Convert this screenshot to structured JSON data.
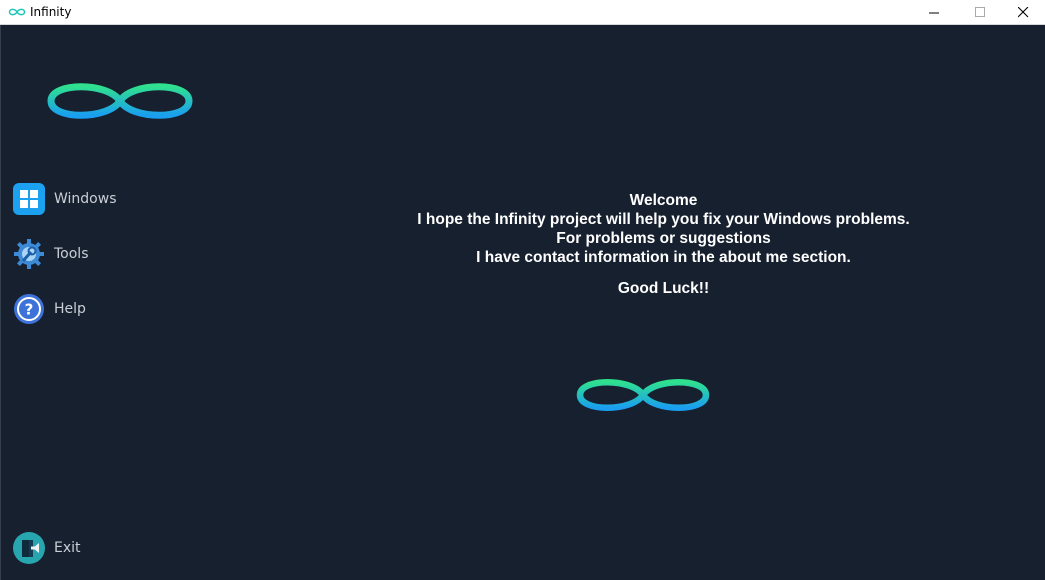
{
  "window": {
    "title": "Infinity",
    "controls": {
      "minimize": "minimize",
      "maximize": "maximize",
      "close": "close"
    }
  },
  "colors": {
    "background": "#17202f",
    "logo_gradient_start": "#2fe08f",
    "logo_gradient_end": "#1a9ff0",
    "text": "#ffffff",
    "sidebar_text": "#c9cfd6"
  },
  "sidebar": {
    "items": [
      {
        "label": "Windows",
        "icon": "windows-icon"
      },
      {
        "label": "Tools",
        "icon": "tools-gear-icon"
      },
      {
        "label": "Help",
        "icon": "help-icon"
      }
    ],
    "exit": {
      "label": "Exit",
      "icon": "exit-door-icon"
    }
  },
  "content": {
    "welcome": "Welcome",
    "line1": "I hope the Infinity project will help you fix your Windows problems.",
    "line2": "For problems or suggestions",
    "line3": "I have contact information in the about me section.",
    "good_luck": "Good Luck!!"
  }
}
